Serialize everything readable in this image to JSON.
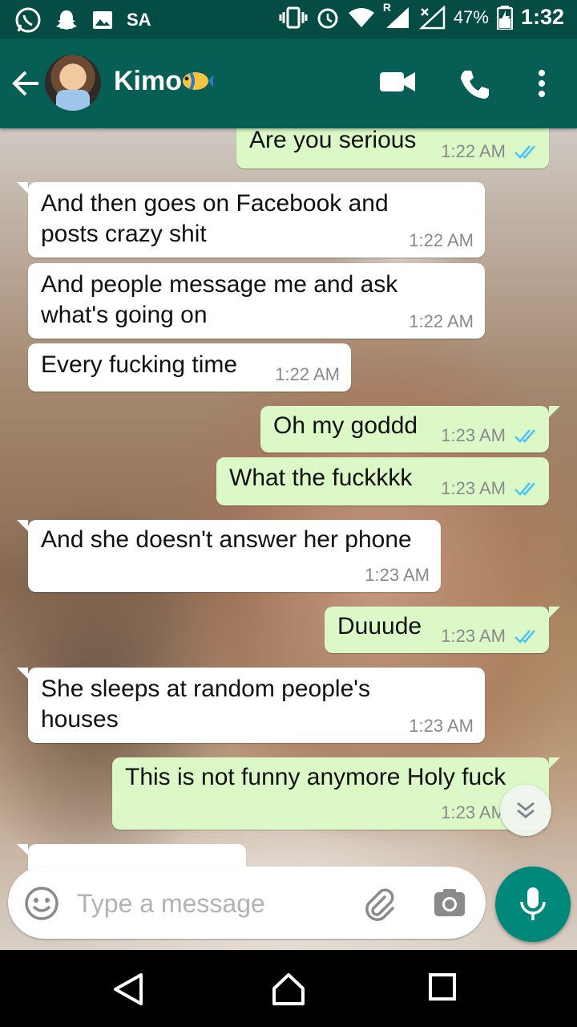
{
  "status_bar": {
    "carrier_text": "SA",
    "battery": "47%",
    "time": "1:32",
    "roaming_mark": "R",
    "icons": [
      "whatsapp-icon",
      "snapchat-icon",
      "gallery-icon",
      "vibrate-icon",
      "alarm-icon",
      "wifi-icon",
      "signal-icon",
      "signal-x-icon",
      "battery-icon"
    ]
  },
  "header": {
    "contact_name": "Kimo",
    "emoji": "tropical-fish",
    "icons": [
      "back-arrow-icon",
      "video-call-icon",
      "phone-icon",
      "more-vert-icon"
    ]
  },
  "messages": [
    {
      "dir": "out",
      "lines": [
        "Are you serious"
      ],
      "time": "1:22 AM",
      "read": true
    },
    {
      "dir": "in",
      "lines": [
        "And then goes on Facebook and",
        "posts crazy shit"
      ],
      "time": "1:22 AM"
    },
    {
      "dir": "in",
      "lines": [
        "And people message me and ask",
        "what's going on"
      ],
      "time": "1:22 AM"
    },
    {
      "dir": "in",
      "lines": [
        "Every fucking time"
      ],
      "time": "1:22 AM"
    },
    {
      "dir": "out",
      "lines": [
        "Oh my goddd"
      ],
      "time": "1:23 AM",
      "read": true
    },
    {
      "dir": "out",
      "lines": [
        "What the fuckkkk"
      ],
      "time": "1:23 AM",
      "read": true
    },
    {
      "dir": "in",
      "lines": [
        "And she doesn't answer her phone"
      ],
      "time": "1:23 AM"
    },
    {
      "dir": "out",
      "lines": [
        "Duuude"
      ],
      "time": "1:23 AM",
      "read": true
    },
    {
      "dir": "in",
      "lines": [
        "She sleeps at random people's",
        "houses"
      ],
      "time": "1:23 AM"
    },
    {
      "dir": "out",
      "lines": [
        "This is not funny anymore Holy fuck"
      ],
      "time": "1:23 AM",
      "read": true
    }
  ],
  "input": {
    "placeholder": "Type a message",
    "icons": [
      "emoji-icon",
      "attach-icon",
      "camera-icon",
      "mic-icon"
    ]
  },
  "colors": {
    "header": "#075e54",
    "status_bar": "#054d44",
    "outgoing_bubble": "#dcf8c6",
    "incoming_bubble": "#ffffff",
    "read_ticks": "#4fc3f7",
    "mic_button": "#00897b"
  }
}
